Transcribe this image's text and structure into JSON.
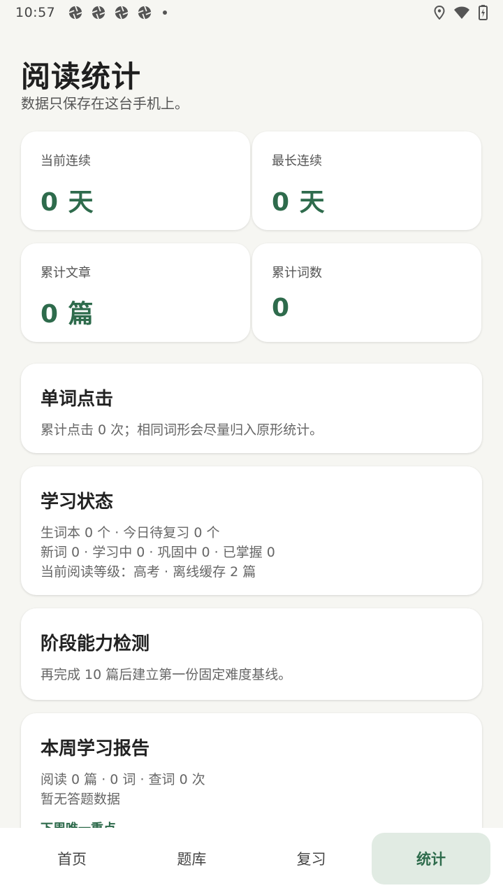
{
  "status_bar": {
    "time": "10:57",
    "notification_icons": [
      "aperture-icon",
      "aperture-icon",
      "aperture-icon",
      "aperture-icon"
    ],
    "right_icons": [
      "location-icon",
      "wifi-icon",
      "battery-charging-icon"
    ]
  },
  "header": {
    "title": "阅读统计",
    "subtitle": "数据只保存在这台手机上。"
  },
  "stats": [
    {
      "label": "当前连续",
      "value": "0 天"
    },
    {
      "label": "最长连续",
      "value": "0 天"
    },
    {
      "label": "累计文章",
      "value": "0 篇"
    },
    {
      "label": "累计词数",
      "value": "0"
    }
  ],
  "cards": {
    "word_clicks": {
      "title": "单词点击",
      "lines": [
        "累计点击 0 次；相同词形会尽量归入原形统计。"
      ]
    },
    "learning_status": {
      "title": "学习状态",
      "lines": [
        "生词本 0 个 · 今日待复习 0 个",
        "新词 0 · 学习中 0 · 巩固中 0 · 已掌握 0",
        "当前阅读等级：高考 · 离线缓存 2 篇"
      ]
    },
    "ability_test": {
      "title": "阶段能力检测",
      "lines": [
        "再完成 10 篇后建立第一份固定难度基线。"
      ]
    },
    "weekly_report": {
      "title": "本周学习报告",
      "lines": [
        "阅读 0 篇 · 0 词 · 查词 0 次",
        "暂无答题数据"
      ],
      "link": "下周唯一重点"
    }
  },
  "bottom_nav": {
    "items": [
      "首页",
      "题库",
      "复习",
      "统计"
    ],
    "active": "统计"
  },
  "colors": {
    "accent": "#2e6b4c",
    "background": "#f6f6f2",
    "active_tab_bg": "#e1ebe3"
  }
}
